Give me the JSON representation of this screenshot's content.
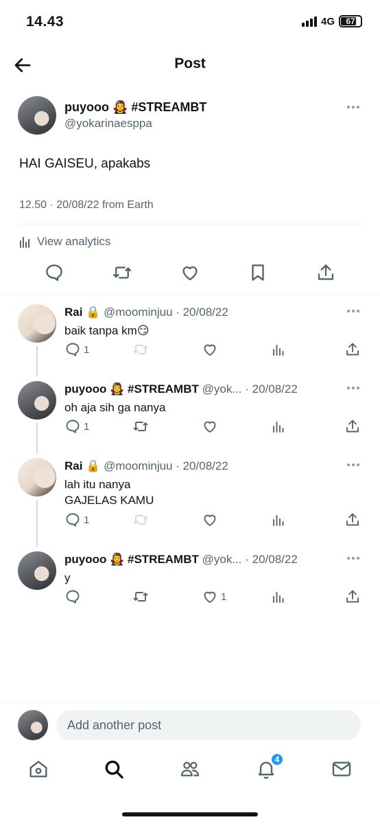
{
  "status_bar": {
    "time": "14.43",
    "network": "4G",
    "battery": "67"
  },
  "header": {
    "title": "Post"
  },
  "main_post": {
    "name": "puyooo 🧛‍♀️ #STREAMBT",
    "handle": "@yokarinaesppa",
    "text": "HAI GAISEU, apakabs",
    "meta": "12.50 · 20/08/22 from Earth",
    "analytics_label": "View analytics"
  },
  "replies": [
    {
      "name": "Rai 🔒",
      "handle": "@moominjuu · 20/08/22",
      "lines": [
        "baik tanpa km😏"
      ],
      "reply_count": "1",
      "like_count": "",
      "avatar": "light"
    },
    {
      "name": "puyooo 🧛‍♀️ #STREAMBT",
      "handle": "@yok... · 20/08/22",
      "lines": [
        "oh aja sih ga nanya"
      ],
      "reply_count": "1",
      "like_count": "",
      "avatar": "dark"
    },
    {
      "name": "Rai 🔒",
      "handle": "@moominjuu · 20/08/22",
      "lines": [
        "lah itu nanya",
        "GAJELAS KAMU"
      ],
      "reply_count": "1",
      "like_count": "",
      "avatar": "light"
    },
    {
      "name": "puyooo 🧛‍♀️ #STREAMBT",
      "handle": "@yok... · 20/08/22",
      "lines": [
        "y"
      ],
      "reply_count": "",
      "like_count": "1",
      "avatar": "dark"
    }
  ],
  "composer": {
    "placeholder": "Add another post"
  },
  "bottom_nav": {
    "notifications_badge": "4"
  },
  "colors": {
    "accent": "#1d9bf0",
    "text": "#0f1419",
    "secondary": "#536471",
    "divider": "#eff3f4"
  },
  "icons": [
    "back-arrow-icon",
    "reply-icon",
    "retweet-icon",
    "like-icon",
    "bookmark-icon",
    "share-icon",
    "analytics-icon",
    "more-icon",
    "home-icon",
    "search-icon",
    "communities-icon",
    "notifications-icon",
    "messages-icon"
  ]
}
